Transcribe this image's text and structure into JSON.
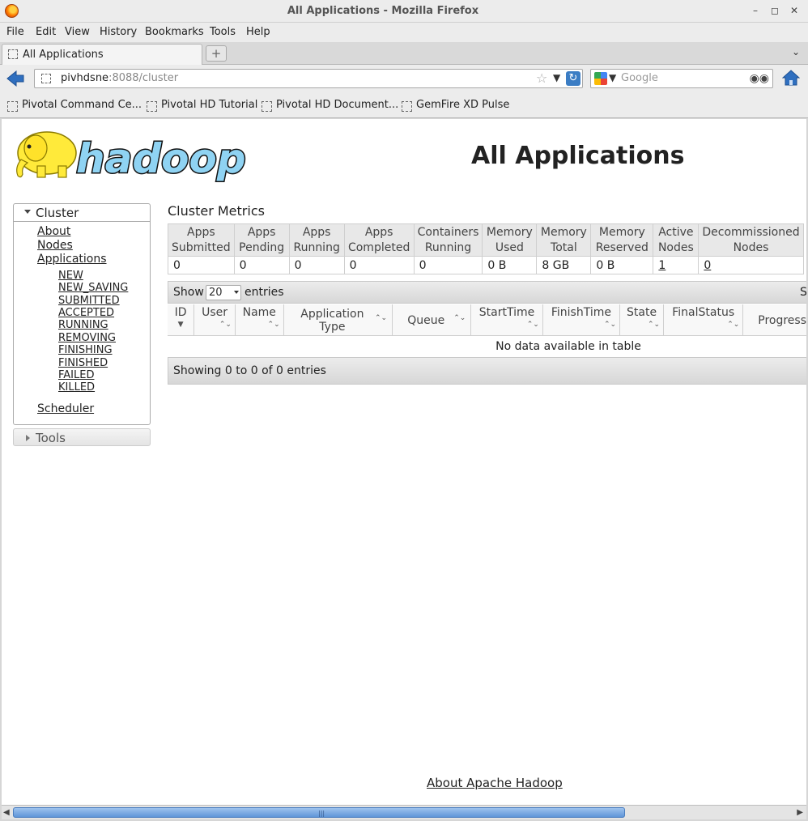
{
  "window": {
    "title": "All Applications - Mozilla Firefox"
  },
  "menu": [
    "File",
    "Edit",
    "View",
    "History",
    "Bookmarks",
    "Tools",
    "Help"
  ],
  "tabs": [
    {
      "label": "All Applications"
    }
  ],
  "nav": {
    "url_host": "pivhdsne",
    "url_rest": ":8088/cluster",
    "search_placeholder": "Google"
  },
  "bookmarks": [
    "Pivotal Command Ce...",
    "Pivotal HD Tutorial",
    "Pivotal HD Document...",
    "GemFire XD Pulse"
  ],
  "page": {
    "logo_text": "hadoop",
    "title": "All Applications",
    "footer_link": "About Apache Hadoop"
  },
  "sidebar": {
    "cluster_label": "Cluster",
    "links": [
      "About",
      "Nodes",
      "Applications"
    ],
    "states": [
      "NEW",
      "NEW_SAVING",
      "SUBMITTED",
      "ACCEPTED",
      "RUNNING",
      "REMOVING",
      "FINISHING",
      "FINISHED",
      "FAILED",
      "KILLED"
    ],
    "scheduler": "Scheduler",
    "tools_label": "Tools"
  },
  "metrics": {
    "title": "Cluster Metrics",
    "headers": [
      [
        "Apps",
        "Submitted"
      ],
      [
        "Apps",
        "Pending"
      ],
      [
        "Apps",
        "Running"
      ],
      [
        "Apps",
        "Completed"
      ],
      [
        "Containers",
        "Running"
      ],
      [
        "Memory",
        "Used"
      ],
      [
        "Memory",
        "Total"
      ],
      [
        "Memory",
        "Reserved"
      ],
      [
        "Active",
        "Nodes"
      ],
      [
        "Decommissioned",
        "Nodes"
      ]
    ],
    "values": [
      "0",
      "0",
      "0",
      "0",
      "0",
      "0 B",
      "8 GB",
      "0 B",
      "1",
      "0"
    ]
  },
  "apps_table": {
    "show": "Show",
    "page_size": "20",
    "entries": "entries",
    "search_label": "Search:",
    "columns": [
      "ID",
      "User",
      "Name",
      "Application Type",
      "Queue",
      "StartTime",
      "FinishTime",
      "State",
      "FinalStatus",
      "Progress"
    ],
    "empty": "No data available in table",
    "info": "Showing 0 to 0 of 0 entries"
  }
}
